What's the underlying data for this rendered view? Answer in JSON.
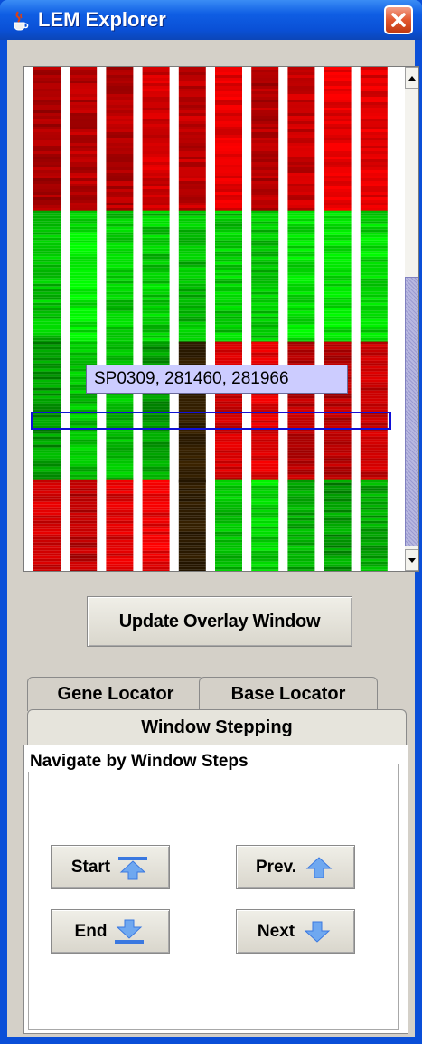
{
  "window": {
    "title": "LEM Explorer",
    "icon": "java-cup-icon",
    "close_icon": "close-icon"
  },
  "heatmap": {
    "columns": 10,
    "row_bands": [
      {
        "id": "top",
        "colors": [
          "red",
          "red",
          "red",
          "red",
          "red",
          "red",
          "red",
          "red",
          "red",
          "red"
        ]
      },
      {
        "id": "green",
        "colors": [
          "green",
          "green",
          "green",
          "green",
          "green",
          "green",
          "green",
          "green",
          "green",
          "green"
        ]
      },
      {
        "id": "mixed",
        "colors": [
          "green",
          "green",
          "green",
          "green",
          "dark",
          "red",
          "red",
          "red",
          "red",
          "red"
        ]
      },
      {
        "id": "bottom",
        "colors": [
          "red",
          "red",
          "red",
          "red",
          "dark",
          "green",
          "green",
          "green",
          "green",
          "green"
        ]
      }
    ],
    "tooltip": "SP0309, 281460, 281966"
  },
  "scrollbar": {
    "up_icon": "arrow-up-icon",
    "down_icon": "arrow-down-icon"
  },
  "update_button": "Update Overlay Window",
  "tabs": [
    {
      "label": "Gene Locator",
      "selected": false
    },
    {
      "label": "Base Locator",
      "selected": false
    },
    {
      "label": "Window Stepping",
      "selected": true
    }
  ],
  "panel": {
    "group_title": "Navigate by Window Steps",
    "buttons": {
      "start": {
        "label": "Start",
        "icon": "arrow-to-top-icon"
      },
      "prev": {
        "label": "Prev.",
        "icon": "arrow-up-icon"
      },
      "end": {
        "label": "End",
        "icon": "arrow-to-bottom-icon"
      },
      "next": {
        "label": "Next",
        "icon": "arrow-down-icon"
      }
    }
  },
  "colors": {
    "titlebar": "#0a50d6",
    "window_bg": "#d4d0c8",
    "tooltip_bg": "#ccccff",
    "highlight": "#1010d8",
    "heat_red": "#e00000",
    "heat_green": "#00d000"
  }
}
